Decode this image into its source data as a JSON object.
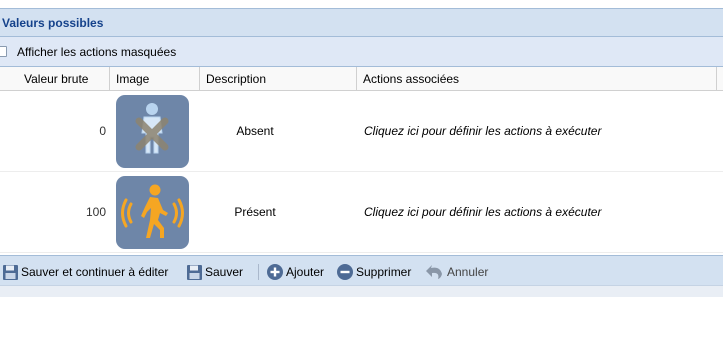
{
  "panel": {
    "title": "Valeurs possibles"
  },
  "options": {
    "show_hidden_label": "Afficher les actions masquées",
    "show_hidden_checked": false
  },
  "columns": [
    "Valeur brute",
    "Image",
    "Description",
    "Actions associées"
  ],
  "rows": [
    {
      "value": "0",
      "image_icon": "person-absent-icon",
      "description": "Absent",
      "action": "Cliquez ici pour définir les actions à exécuter"
    },
    {
      "value": "100",
      "image_icon": "person-present-icon",
      "description": "Présent",
      "action": "Cliquez ici pour définir les actions à exécuter"
    }
  ],
  "toolbar": {
    "save_continue": "Sauver et continuer à éditer",
    "save": "Sauver",
    "add": "Ajouter",
    "delete": "Supprimer",
    "cancel": "Annuler"
  },
  "colors": {
    "accent": "#15428b",
    "panel_bg": "#d3e1f1",
    "icon_tile": "#6e86a8",
    "present_icon": "#f5a623"
  }
}
